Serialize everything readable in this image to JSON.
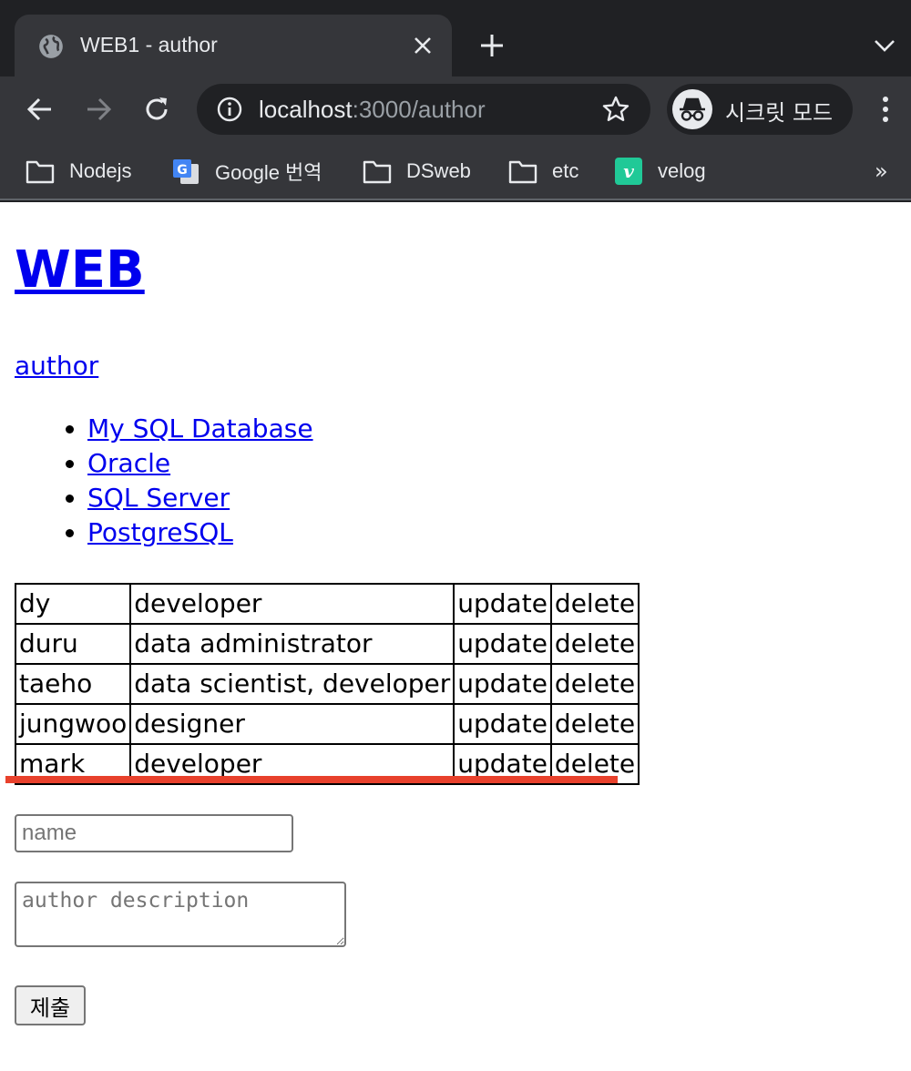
{
  "browser": {
    "tab": {
      "title": "WEB1 - author",
      "icon": "globe-icon"
    },
    "address_bar": {
      "host": "localhost",
      "rest": ":3000/author"
    },
    "incognito_label": "시크릿 모드",
    "bookmarks": [
      {
        "label": "Nodejs",
        "icon": "folder-icon"
      },
      {
        "label": "Google 번역",
        "icon": "google-translate-icon"
      },
      {
        "label": "DSweb",
        "icon": "folder-icon"
      },
      {
        "label": "etc",
        "icon": "folder-icon"
      },
      {
        "label": "velog",
        "icon": "velog-icon"
      }
    ],
    "bookmarks_overflow": "»"
  },
  "page": {
    "title": "WEB",
    "author_link": "author",
    "databases": [
      "My SQL Database",
      "Oracle",
      "SQL Server",
      "PostgreSQL"
    ],
    "authors": [
      {
        "name": "dy",
        "description": "developer",
        "update": "update",
        "delete": "delete"
      },
      {
        "name": "duru",
        "description": "data administrator",
        "update": "update",
        "delete": "delete"
      },
      {
        "name": "taeho",
        "description": "data scientist, developer",
        "update": "update",
        "delete": "delete"
      },
      {
        "name": "jungwoo",
        "description": "designer",
        "update": "update",
        "delete": "delete"
      },
      {
        "name": "mark",
        "description": "developer",
        "update": "update",
        "delete": "delete"
      }
    ],
    "form": {
      "name_placeholder": "name",
      "description_placeholder": "author description",
      "submit_label": "제출"
    },
    "highlight_color": "#e8412c",
    "link_color": "#0000ee"
  }
}
